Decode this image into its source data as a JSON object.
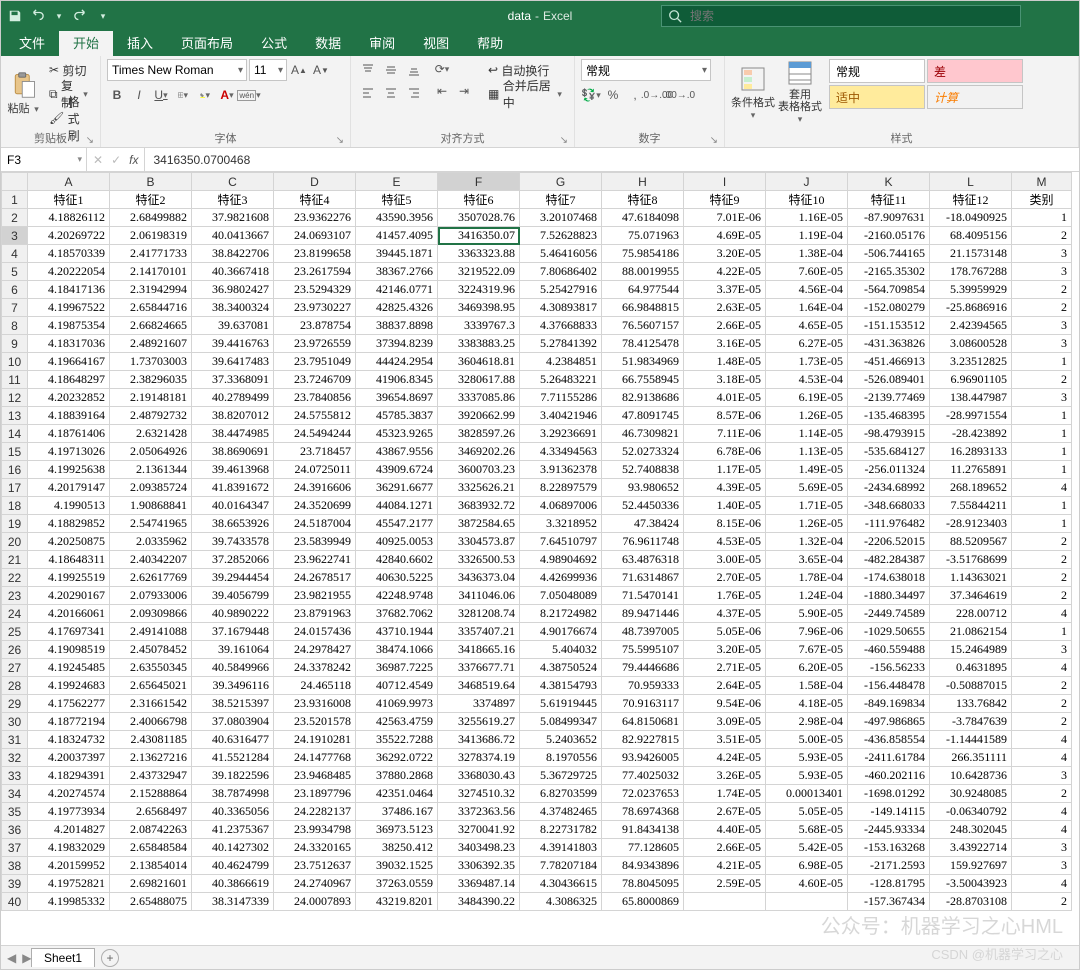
{
  "title": {
    "doc": "data",
    "sep": "-",
    "app": "Excel"
  },
  "qat": {
    "save": "💾",
    "undo": "↶",
    "redo": "↷",
    "more": "▾"
  },
  "search": {
    "placeholder": "搜索"
  },
  "tabs": [
    "文件",
    "开始",
    "插入",
    "页面布局",
    "公式",
    "数据",
    "审阅",
    "视图",
    "帮助"
  ],
  "active_tab": 1,
  "ribbon": {
    "clipboard": {
      "paste": "粘贴",
      "cut": "剪切",
      "copy": "复制",
      "painter": "格式刷",
      "label": "剪贴板"
    },
    "font": {
      "name": "Times New Roman",
      "size": "11",
      "bold": "B",
      "italic": "I",
      "underline": "U",
      "label": "字体",
      "phonetic_badge": "wén"
    },
    "align": {
      "wrap": "自动换行",
      "merge": "合并后居中",
      "label": "对齐方式"
    },
    "number": {
      "format": "常规",
      "label": "数字"
    },
    "styles": {
      "cond": "条件格式",
      "table": "套用\n表格格式",
      "normal": "常规",
      "bad": "差",
      "neutral": "适中",
      "calc": "计算",
      "label": "样式"
    }
  },
  "namebox": "F3",
  "formula": "3416350.0700468",
  "columns": [
    "A",
    "B",
    "C",
    "D",
    "E",
    "F",
    "G",
    "H",
    "I",
    "J",
    "K",
    "L",
    "M"
  ],
  "headers": [
    "特征1",
    "特征2",
    "特征3",
    "特征4",
    "特征5",
    "特征6",
    "特征7",
    "特征8",
    "特征9",
    "特征10",
    "特征11",
    "特征12",
    "类别"
  ],
  "selected": {
    "row": 3,
    "col": 5
  },
  "rows": [
    [
      "4.18826112",
      "2.68499882",
      "37.9821608",
      "23.9362276",
      "43590.3956",
      "3507028.76",
      "3.20107468",
      "47.6184098",
      "7.01E-06",
      "1.16E-05",
      "-87.9097631",
      "-18.0490925",
      "1"
    ],
    [
      "4.20269722",
      "2.06198319",
      "40.0413667",
      "24.0693107",
      "41457.4095",
      "3416350.07",
      "7.52628823",
      "75.071963",
      "4.69E-05",
      "1.19E-04",
      "-2160.05176",
      "68.4095156",
      "2"
    ],
    [
      "4.18570339",
      "2.41771733",
      "38.8422706",
      "23.8199658",
      "39445.1871",
      "3363323.88",
      "5.46416056",
      "75.9854186",
      "3.20E-05",
      "1.38E-04",
      "-506.744165",
      "21.1573148",
      "3"
    ],
    [
      "4.20222054",
      "2.14170101",
      "40.3667418",
      "23.2617594",
      "38367.2766",
      "3219522.09",
      "7.80686402",
      "88.0019955",
      "4.22E-05",
      "7.60E-05",
      "-2165.35302",
      "178.767288",
      "3"
    ],
    [
      "4.18417136",
      "2.31942994",
      "36.9802427",
      "23.5294329",
      "42146.0771",
      "3224319.96",
      "5.25427916",
      "64.977544",
      "3.37E-05",
      "4.56E-04",
      "-564.709854",
      "5.39959929",
      "2"
    ],
    [
      "4.19967522",
      "2.65844716",
      "38.3400324",
      "23.9730227",
      "42825.4326",
      "3469398.95",
      "4.30893817",
      "66.9848815",
      "2.63E-05",
      "1.64E-04",
      "-152.080279",
      "-25.8686916",
      "2"
    ],
    [
      "4.19875354",
      "2.66824665",
      "39.637081",
      "23.878754",
      "38837.8898",
      "3339767.3",
      "4.37668833",
      "76.5607157",
      "2.66E-05",
      "4.65E-05",
      "-151.153512",
      "2.42394565",
      "3"
    ],
    [
      "4.18317036",
      "2.48921607",
      "39.4416763",
      "23.9726559",
      "37394.8239",
      "3383883.25",
      "5.27841392",
      "78.4125478",
      "3.16E-05",
      "6.27E-05",
      "-431.363826",
      "3.08600528",
      "3"
    ],
    [
      "4.19664167",
      "1.73703003",
      "39.6417483",
      "23.7951049",
      "44424.2954",
      "3604618.81",
      "4.2384851",
      "51.9834969",
      "1.48E-05",
      "1.73E-05",
      "-451.466913",
      "3.23512825",
      "1"
    ],
    [
      "4.18648297",
      "2.38296035",
      "37.3368091",
      "23.7246709",
      "41906.8345",
      "3280617.88",
      "5.26483221",
      "66.7558945",
      "3.18E-05",
      "4.53E-04",
      "-526.089401",
      "6.96901105",
      "2"
    ],
    [
      "4.20232852",
      "2.19148181",
      "40.2789499",
      "23.7840856",
      "39654.8697",
      "3337085.86",
      "7.71155286",
      "82.9138686",
      "4.01E-05",
      "6.19E-05",
      "-2139.77469",
      "138.447987",
      "3"
    ],
    [
      "4.18839164",
      "2.48792732",
      "38.8207012",
      "24.5755812",
      "45785.3837",
      "3920662.99",
      "3.40421946",
      "47.8091745",
      "8.57E-06",
      "1.26E-05",
      "-135.468395",
      "-28.9971554",
      "1"
    ],
    [
      "4.18761406",
      "2.6321428",
      "38.4474985",
      "24.5494244",
      "45323.9265",
      "3828597.26",
      "3.29236691",
      "46.7309821",
      "7.11E-06",
      "1.14E-05",
      "-98.4793915",
      "-28.423892",
      "1"
    ],
    [
      "4.19713026",
      "2.05064926",
      "38.8690691",
      "23.718457",
      "43867.9556",
      "3469202.26",
      "4.33494563",
      "52.0273324",
      "6.78E-06",
      "1.13E-05",
      "-535.684127",
      "16.2893133",
      "1"
    ],
    [
      "4.19925638",
      "2.1361344",
      "39.4613968",
      "24.0725011",
      "43909.6724",
      "3600703.23",
      "3.91362378",
      "52.7408838",
      "1.17E-05",
      "1.49E-05",
      "-256.011324",
      "11.2765891",
      "1"
    ],
    [
      "4.20179147",
      "2.09385724",
      "41.8391672",
      "24.3916606",
      "36291.6677",
      "3325626.21",
      "8.22897579",
      "93.980652",
      "4.39E-05",
      "5.69E-05",
      "-2434.68992",
      "268.189652",
      "4"
    ],
    [
      "4.1990513",
      "1.90868841",
      "40.0164347",
      "24.3520699",
      "44084.1271",
      "3683932.72",
      "4.06897006",
      "52.4450336",
      "1.40E-05",
      "1.71E-05",
      "-348.668033",
      "7.55844211",
      "1"
    ],
    [
      "4.18829852",
      "2.54741965",
      "38.6653926",
      "24.5187004",
      "45547.2177",
      "3872584.65",
      "3.3218952",
      "47.38424",
      "8.15E-06",
      "1.26E-05",
      "-111.976482",
      "-28.9123403",
      "1"
    ],
    [
      "4.20250875",
      "2.0335962",
      "39.7433578",
      "23.5839949",
      "40925.0053",
      "3304573.87",
      "7.64510797",
      "76.9611748",
      "4.53E-05",
      "1.32E-04",
      "-2206.52015",
      "88.5209567",
      "2"
    ],
    [
      "4.18648311",
      "2.40342207",
      "37.2852066",
      "23.9622741",
      "42840.6602",
      "3326500.53",
      "4.98904692",
      "63.4876318",
      "3.00E-05",
      "3.65E-04",
      "-482.284387",
      "-3.51768699",
      "2"
    ],
    [
      "4.19925519",
      "2.62617769",
      "39.2944454",
      "24.2678517",
      "40630.5225",
      "3436373.04",
      "4.42699936",
      "71.6314867",
      "2.70E-05",
      "1.78E-04",
      "-174.638018",
      "1.14363021",
      "2"
    ],
    [
      "4.20290167",
      "2.07933006",
      "39.4056799",
      "23.9821955",
      "42248.9748",
      "3411046.06",
      "7.05048089",
      "71.5470141",
      "1.76E-05",
      "1.24E-04",
      "-1880.34497",
      "37.3464619",
      "2"
    ],
    [
      "4.20166061",
      "2.09309866",
      "40.9890222",
      "23.8791963",
      "37682.7062",
      "3281208.74",
      "8.21724982",
      "89.9471446",
      "4.37E-05",
      "5.90E-05",
      "-2449.74589",
      "228.00712",
      "4"
    ],
    [
      "4.17697341",
      "2.49141088",
      "37.1679448",
      "24.0157436",
      "43710.1944",
      "3357407.21",
      "4.90176674",
      "48.7397005",
      "5.05E-06",
      "7.96E-06",
      "-1029.50655",
      "21.0862154",
      "1"
    ],
    [
      "4.19098519",
      "2.45078452",
      "39.161064",
      "24.2978427",
      "38474.1066",
      "3418665.16",
      "5.404032",
      "75.5995107",
      "3.20E-05",
      "7.67E-05",
      "-460.559488",
      "15.2464989",
      "3"
    ],
    [
      "4.19245485",
      "2.63550345",
      "40.5849966",
      "24.3378242",
      "36987.7225",
      "3376677.71",
      "4.38750524",
      "79.4446686",
      "2.71E-05",
      "6.20E-05",
      "-156.56233",
      "0.4631895",
      "4"
    ],
    [
      "4.19924683",
      "2.65645021",
      "39.3496116",
      "24.465118",
      "40712.4549",
      "3468519.64",
      "4.38154793",
      "70.959333",
      "2.64E-05",
      "1.58E-04",
      "-156.448478",
      "-0.50887015",
      "2"
    ],
    [
      "4.17562277",
      "2.31661542",
      "38.5215397",
      "23.9316008",
      "41069.9973",
      "3374897",
      "5.61919445",
      "70.9163117",
      "9.54E-06",
      "4.18E-05",
      "-849.169834",
      "133.76842",
      "2"
    ],
    [
      "4.18772194",
      "2.40066798",
      "37.0803904",
      "23.5201578",
      "42563.4759",
      "3255619.27",
      "5.08499347",
      "64.8150681",
      "3.09E-05",
      "2.98E-04",
      "-497.986865",
      "-3.7847639",
      "2"
    ],
    [
      "4.18324732",
      "2.43081185",
      "40.6316477",
      "24.1910281",
      "35522.7288",
      "3413686.72",
      "5.2403652",
      "82.9227815",
      "3.51E-05",
      "5.00E-05",
      "-436.858554",
      "-1.14441589",
      "4"
    ],
    [
      "4.20037397",
      "2.13627216",
      "41.5521284",
      "24.1477768",
      "36292.0722",
      "3278374.19",
      "8.1970556",
      "93.9426005",
      "4.24E-05",
      "5.93E-05",
      "-2411.61784",
      "266.351111",
      "4"
    ],
    [
      "4.18294391",
      "2.43732947",
      "39.1822596",
      "23.9468485",
      "37880.2868",
      "3368030.43",
      "5.36729725",
      "77.4025032",
      "3.26E-05",
      "5.93E-05",
      "-460.202116",
      "10.6428736",
      "3"
    ],
    [
      "4.20274574",
      "2.15288864",
      "38.7874998",
      "23.1897796",
      "42351.0464",
      "3274510.32",
      "6.82703599",
      "72.0237653",
      "1.74E-05",
      "0.00013401",
      "-1698.01292",
      "30.9248085",
      "2"
    ],
    [
      "4.19773934",
      "2.6568497",
      "40.3365056",
      "24.2282137",
      "37486.167",
      "3372363.56",
      "4.37482465",
      "78.6974368",
      "2.67E-05",
      "5.05E-05",
      "-149.14115",
      "-0.06340792",
      "4"
    ],
    [
      "4.2014827",
      "2.08742263",
      "41.2375367",
      "23.9934798",
      "36973.5123",
      "3270041.92",
      "8.22731782",
      "91.8434138",
      "4.40E-05",
      "5.68E-05",
      "-2445.93334",
      "248.302045",
      "4"
    ],
    [
      "4.19832029",
      "2.65848584",
      "40.1427302",
      "24.3320165",
      "38250.412",
      "3403498.23",
      "4.39141803",
      "77.128605",
      "2.66E-05",
      "5.42E-05",
      "-153.163268",
      "3.43922714",
      "3"
    ],
    [
      "4.20159952",
      "2.13854014",
      "40.4624799",
      "23.7512637",
      "39032.1525",
      "3306392.35",
      "7.78207184",
      "84.9343896",
      "4.21E-05",
      "6.98E-05",
      "-2171.2593",
      "159.927697",
      "3"
    ],
    [
      "4.19752821",
      "2.69821601",
      "40.3866619",
      "24.2740967",
      "37263.0559",
      "3369487.14",
      "4.30436615",
      "78.8045095",
      "2.59E-05",
      "4.60E-05",
      "-128.81795",
      "-3.50043923",
      "4"
    ],
    [
      "4.19985332",
      "2.65488075",
      "38.3147339",
      "24.0007893",
      "43219.8201",
      "3484390.22",
      "4.3086325",
      "65.8000869",
      "",
      "",
      "-157.367434",
      "-28.8703108",
      "2"
    ]
  ],
  "sheettab": "Sheet1",
  "watermark": "公众号：机器学习之心HML",
  "watermark2": "CSDN @机器学习之心"
}
